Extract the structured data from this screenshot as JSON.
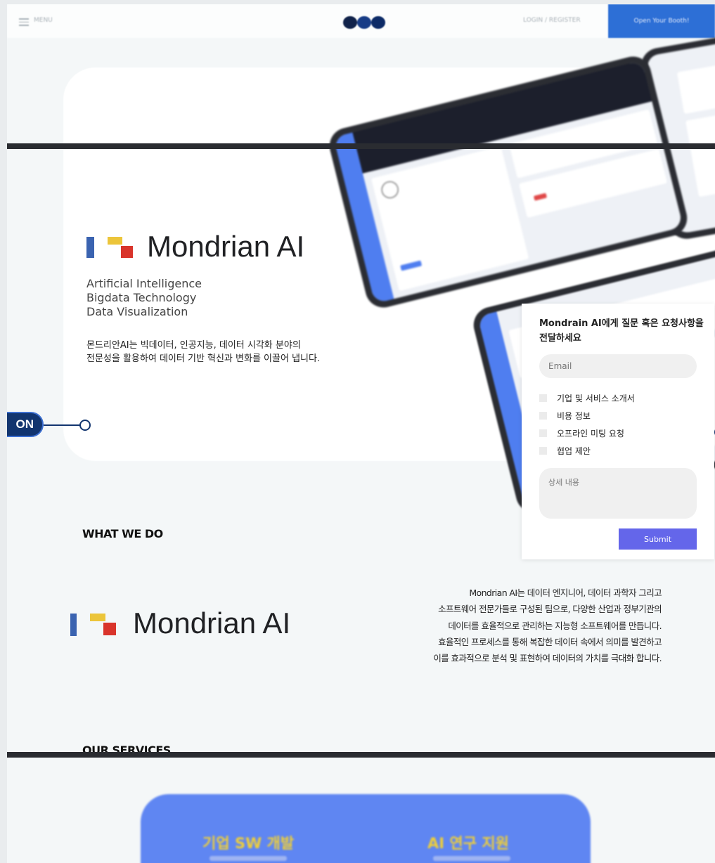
{
  "header": {
    "menu_label": "MENU",
    "login_label": "LOGIN / REGISTER",
    "cta_label": "Open Your Booth!"
  },
  "hero": {
    "brand_name": "Mondrian AI",
    "taglines": [
      "Artificial Intelligence",
      "Bigdata Technology",
      "Data Visualization"
    ],
    "intro_lines": [
      "몬드리안AI는 빅데이터, 인공지능, 데이터 시각화 분야의",
      "전문성을 활용하여 데이터 기반 혁신과 변화를 이끌어 냅니다."
    ],
    "badge_label": "ON"
  },
  "contact_form": {
    "title": "Mondrain AI에게 질문 혹은 요청사항을 전달하세요",
    "email_placeholder": "Email",
    "options": [
      "기업 및 서비스 소개서",
      "비용 정보",
      "오프라인 미팅 요청",
      "협업 제안"
    ],
    "detail_placeholder": "상세 내용",
    "submit_label": "Submit"
  },
  "what_we_do": {
    "title": "WHAT WE DO",
    "brand_name": "Mondrian AI",
    "description_lines": [
      "Mondrian AI는 데이터 엔지니어, 데이터 과학자 그리고",
      "소프트웨어 전문가들로 구성된 팀으로, 다양한 산업과 정부기관의",
      "데이터를 효율적으로 관리하는 지능형 소프트웨어를 만듭니다.",
      "효율적인 프로세스를 통해 복잡한 데이터 속에서 의미를 발견하고",
      "이를 효과적으로 분석 및 표현하여 데이터의 가치를 극대화 합니다."
    ]
  },
  "our_services": {
    "title": "OUR SERVICES",
    "items": [
      {
        "title": "기업 SW 개발"
      },
      {
        "title": "AI 연구 지원"
      }
    ]
  },
  "colors": {
    "brand_blue": "#3a63b0",
    "brand_yellow": "#ecc53a",
    "brand_red": "#d9342b",
    "cta_blue": "#2d6fd6",
    "submit_purple": "#6466ea",
    "services_blue": "#5f86f2"
  },
  "icons": [
    "hamburger-menu-icon",
    "logo-dots-icon",
    "mondrian-logo-icon",
    "connector-ring-icon",
    "checkbox-icon"
  ]
}
